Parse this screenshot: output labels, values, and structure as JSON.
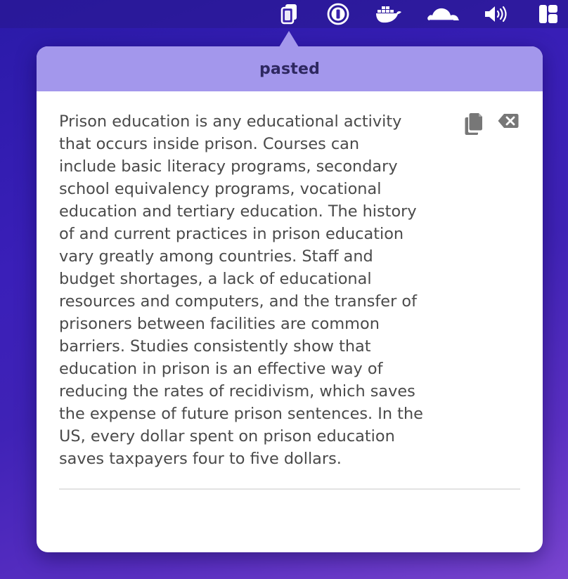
{
  "menubar": {
    "icons": [
      "clipboard-icon",
      "1password-icon",
      "docker-icon",
      "cloudflare-icon",
      "volume-icon",
      "layout-icon"
    ]
  },
  "popover": {
    "title": "pasted",
    "entry": {
      "text": "Prison education is any educational activity\nthat occurs inside prison. Courses can\ninclude basic literacy programs, secondary\nschool equivalency programs, vocational\neducation and tertiary education. The history\nof and current practices in prison education\nvary greatly among countries. Staff and\nbudget shortages, a lack of educational\nresources and computers, and the transfer of\nprisoners between facilities are common\nbarriers. Studies consistently show that\neducation in prison is an effective way of\nreducing the rates of recidivism, which saves\nthe expense of future prison sentences. In the\nUS, every dollar spent on prison education\nsaves taxpayers four to five dollars.",
      "actions": [
        "copy-icon",
        "delete-icon"
      ]
    }
  },
  "colors": {
    "header": "#a397ec",
    "title": "#2e2860",
    "text": "#4a4a4a",
    "icon": "#777777"
  }
}
